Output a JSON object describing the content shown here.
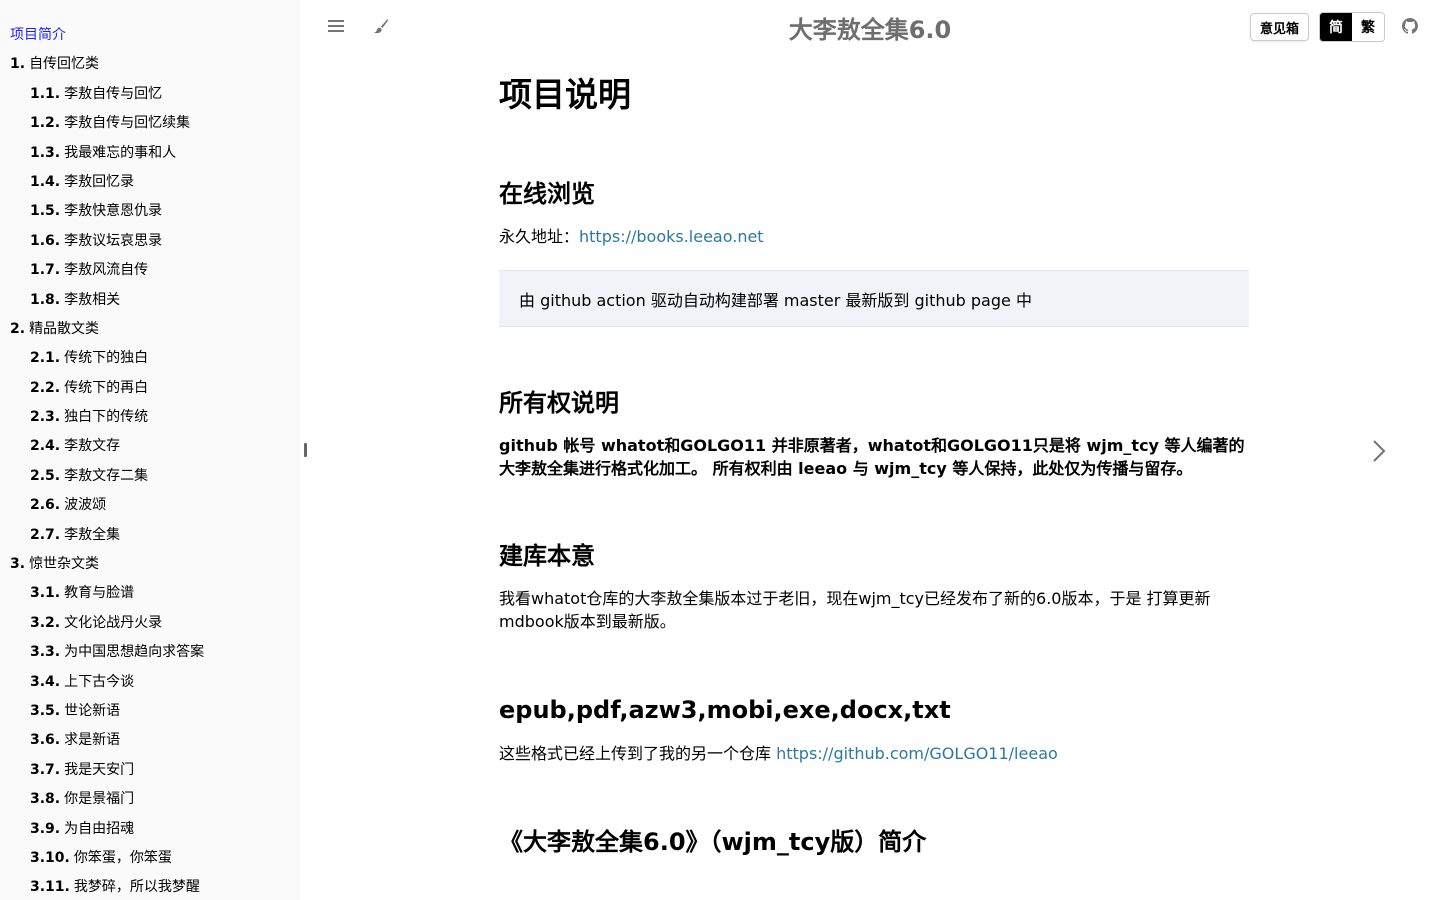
{
  "sidebar": {
    "items": [
      {
        "num": "",
        "label": "项目简介",
        "level": 0,
        "active": true
      },
      {
        "num": "1.",
        "label": "自传回忆类",
        "level": 0
      },
      {
        "num": "1.1.",
        "label": "李敖自传与回忆",
        "level": 1
      },
      {
        "num": "1.2.",
        "label": "李敖自传与回忆续集",
        "level": 1
      },
      {
        "num": "1.3.",
        "label": "我最难忘的事和人",
        "level": 1
      },
      {
        "num": "1.4.",
        "label": "李敖回忆录",
        "level": 1
      },
      {
        "num": "1.5.",
        "label": "李敖快意恩仇录",
        "level": 1
      },
      {
        "num": "1.6.",
        "label": "李敖议坛哀思录",
        "level": 1
      },
      {
        "num": "1.7.",
        "label": "李敖风流自传",
        "level": 1
      },
      {
        "num": "1.8.",
        "label": "李敖相关",
        "level": 1
      },
      {
        "num": "2.",
        "label": "精品散文类",
        "level": 0
      },
      {
        "num": "2.1.",
        "label": "传统下的独白",
        "level": 1
      },
      {
        "num": "2.2.",
        "label": "传统下的再白",
        "level": 1
      },
      {
        "num": "2.3.",
        "label": "独白下的传统",
        "level": 1
      },
      {
        "num": "2.4.",
        "label": "李敖文存",
        "level": 1
      },
      {
        "num": "2.5.",
        "label": "李敖文存二集",
        "level": 1
      },
      {
        "num": "2.6.",
        "label": "波波颂",
        "level": 1
      },
      {
        "num": "2.7.",
        "label": "李敖全集",
        "level": 1
      },
      {
        "num": "3.",
        "label": "惊世杂文类",
        "level": 0
      },
      {
        "num": "3.1.",
        "label": "教育与脸谱",
        "level": 1
      },
      {
        "num": "3.2.",
        "label": "文化论战丹火录",
        "level": 1
      },
      {
        "num": "3.3.",
        "label": "为中国思想趋向求答案",
        "level": 1
      },
      {
        "num": "3.4.",
        "label": "上下古今谈",
        "level": 1
      },
      {
        "num": "3.5.",
        "label": "世论新语",
        "level": 1
      },
      {
        "num": "3.6.",
        "label": "求是新语",
        "level": 1
      },
      {
        "num": "3.7.",
        "label": "我是天安门",
        "level": 1
      },
      {
        "num": "3.8.",
        "label": "你是景福门",
        "level": 1
      },
      {
        "num": "3.9.",
        "label": "为自由招魂",
        "level": 1
      },
      {
        "num": "3.10.",
        "label": "你笨蛋，你笨蛋",
        "level": 1
      },
      {
        "num": "3.11.",
        "label": "我梦碎，所以我梦醒",
        "level": 1
      }
    ]
  },
  "header": {
    "title": "大李敖全集6.0",
    "feedback_label": "意见箱",
    "lang_simplified": "简",
    "lang_traditional": "繁",
    "icons": [
      "menu-icon",
      "paintbrush-icon",
      "github-icon"
    ]
  },
  "content": {
    "h1": "项目说明",
    "section_online": {
      "title": "在线浏览",
      "prefix": "永久地址：",
      "link": "https://books.leeao.net",
      "quote": "由 github action 驱动自动构建部署 master 最新版到 github page 中"
    },
    "section_ownership": {
      "title": "所有权说明",
      "text": "github 帐号 whatot和GOLGO11 并非原著者，whatot和GOLGO11只是将 wjm_tcy 等人编著的大李敖全集进行格式化加工。 所有权利由 leeao 与 wjm_tcy 等人保持，此处仅为传播与留存。"
    },
    "section_purpose": {
      "title": "建库本意",
      "text": "我看whatot仓库的大李敖全集版本过于老旧，现在wjm_tcy已经发布了新的6.0版本，于是 打算更新mdbook版本到最新版。"
    },
    "section_formats": {
      "title": "epub,pdf,azw3,mobi,exe,docx,txt",
      "prefix": "这些格式已经上传到了我的另一个仓库 ",
      "link": "https://github.com/GOLGO11/leeao"
    },
    "section_intro": {
      "title": "《大李敖全集6.0》（wjm_tcy版）简介"
    }
  },
  "colors": {
    "link": "#2b79a2",
    "active_toc": "#1f1fff",
    "sidebar_bg": "#fafafa",
    "quote_bg": "#f1f3f8"
  }
}
